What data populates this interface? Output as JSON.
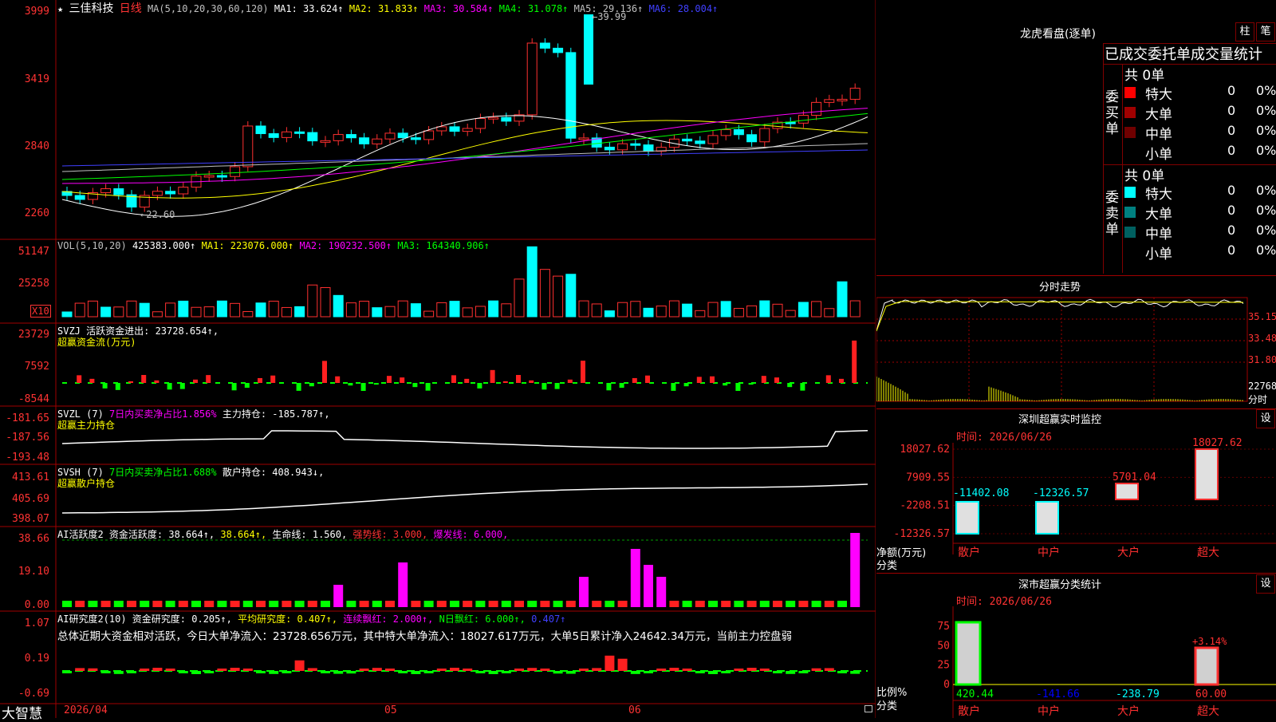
{
  "stock": {
    "name": "三佳科技",
    "period": "日线",
    "ma_params": "MA(5,10,20,30,60,120)",
    "ma1": "MA1: 33.624↑",
    "ma2": "MA2: 31.833↑",
    "ma3": "MA3: 30.584↑",
    "ma4": "MA4: 31.078↑",
    "ma5": "MA5: 29.136↑",
    "ma6": "MA6: 28.004↑",
    "high_mark": "←39.99",
    "low_mark": "←22.60",
    "price_axis": [
      "3999",
      "3419",
      "2840",
      "2260"
    ]
  },
  "vol": {
    "label": "VOL(5,10,20)",
    "value": "425383.000↑",
    "ma1": "MA1: 223076.000↑",
    "ma2": "MA2: 190232.500↑",
    "ma3": "MA3: 164340.906↑",
    "axis": [
      "51147",
      "25258"
    ],
    "unit": "X10"
  },
  "svzj": {
    "label": "SVZJ  活跃资金进出: 23728.654↑,",
    "sub": "超赢资金流(万元)",
    "axis": [
      "23729",
      "7592",
      "-8544"
    ]
  },
  "svzl": {
    "label": "SVZL (7)",
    "note": "7日内买卖净占比1.856%",
    "value": "主力持仓: -185.787↑,",
    "sub": "超赢主力持仓",
    "axis": [
      "-181.65",
      "-187.56",
      "-193.48"
    ]
  },
  "svsh": {
    "label": "SVSH (7)",
    "note": "7日内买卖净占比1.688%",
    "value": "散户持仓: 408.943↓,",
    "sub": "超赢散户持仓",
    "axis": [
      "413.61",
      "405.69",
      "398.07"
    ]
  },
  "ai_active": {
    "label": "AI活跃度2 资金活跃度: 38.664↑, ",
    "v2": "38.664↑,",
    "life": "生命线: 1.560,",
    "strong": "强势线: 3.000,",
    "burst": "爆发线: 6.000,",
    "axis": [
      "38.66",
      "19.10",
      "0.00"
    ]
  },
  "ai_research": {
    "label": "AI研究度2(10) 资金研究度: 0.205↑,",
    "avg": "平均研究度: 0.407↑,",
    "cont": "连续飘红: 2.000↑,",
    "nday": "N日飘红: 6.000↑,",
    "last": "0.407↑",
    "summary": "总体近期大资金相对活跃，今日大单净流入：23728.656万元，其中特大单净流入：18027.617万元，大单5日累计净入24642.34万元，当前主力控盘弱",
    "axis": [
      "1.07",
      "0.19",
      "-0.69"
    ]
  },
  "footer": {
    "brand": "大智慧",
    "dates": [
      "2026/04",
      "05",
      "06"
    ]
  },
  "right": {
    "lhb_title": "龙虎看盘(逐单)",
    "btn_bar": "柱",
    "btn_pen": "笔",
    "header": "已成交委托单成交量统计",
    "buy_label": "委买单",
    "sell_label": "委卖单",
    "buy_total": "共 0单",
    "sell_total": "共 0单",
    "buy_rows": [
      {
        "name": "特大",
        "count": "0",
        "pct": "0%",
        "color": "#ff0000"
      },
      {
        "name": "大单",
        "count": "0",
        "pct": "0%",
        "color": "#a00000"
      },
      {
        "name": "中单",
        "count": "0",
        "pct": "0%",
        "color": "#700000"
      },
      {
        "name": "小单",
        "count": "0",
        "pct": "0%",
        "color": "#000000"
      }
    ],
    "sell_rows": [
      {
        "name": "特大",
        "count": "0",
        "pct": "0%",
        "color": "#00ffff"
      },
      {
        "name": "大单",
        "count": "0",
        "pct": "0%",
        "color": "#008080"
      },
      {
        "name": "中单",
        "count": "0",
        "pct": "0%",
        "color": "#006060"
      },
      {
        "name": "小单",
        "count": "0",
        "pct": "0%",
        "color": "#000000"
      }
    ],
    "intraday_title": "分时走势",
    "intraday_axis": [
      "35.15",
      "33.48",
      "31.80"
    ],
    "intraday_vol": "22768",
    "intraday_unit": "分时",
    "sz_monitor_title": "深圳超赢实时监控",
    "set_label": "设",
    "time_label": "时间: 2026/06/26",
    "monitor_axis": [
      "18027.62",
      "7909.55",
      "-2208.51",
      "-12326.57"
    ],
    "monitor_unit": "净额(万元)",
    "monitor_unit2": "分类",
    "monitor_chart": {
      "type": "bar",
      "categories": [
        "散户",
        "中户",
        "大户",
        "超大"
      ],
      "values": [
        -11402.08,
        -12326.57,
        5701.04,
        18027.62
      ],
      "value_labels": [
        "-11402.08",
        "-12326.57",
        "5701.04",
        "18027.62"
      ],
      "ylim": [
        -12326.57,
        18027.62
      ]
    },
    "sz_class_title": "深市超赢分类统计",
    "class_time": "时间: 2026/06/26",
    "class_axis": [
      "75",
      "50",
      "25",
      "0"
    ],
    "class_unit": "比例%",
    "class_unit2": "分类",
    "class_chart": {
      "type": "bar",
      "categories": [
        "散户",
        "中户",
        "大户",
        "超大"
      ],
      "values": [
        420.44,
        -141.66,
        -238.79,
        60.0
      ],
      "value_labels": [
        "420.44",
        "-141.66",
        "-238.79",
        "60.00"
      ],
      "pct_label": "+3.14%"
    }
  }
}
